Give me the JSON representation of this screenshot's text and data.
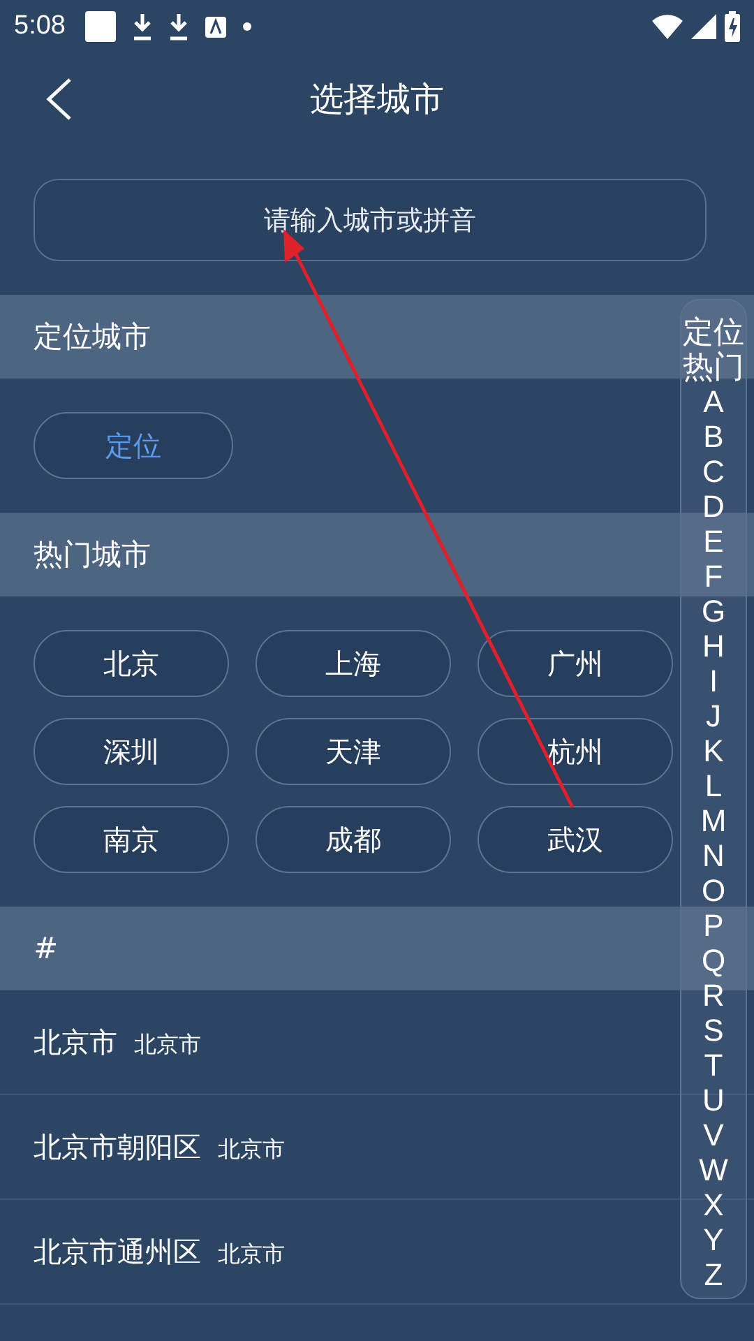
{
  "status_bar": {
    "time": "5:08"
  },
  "header": {
    "title": "选择城市"
  },
  "search": {
    "placeholder": "请输入城市或拼音"
  },
  "location_section": {
    "title": "定位城市",
    "button": "定位"
  },
  "hot_section": {
    "title": "热门城市",
    "cities": [
      "北京",
      "上海",
      "广州",
      "深圳",
      "天津",
      "杭州",
      "南京",
      "成都",
      "武汉"
    ]
  },
  "list_section": {
    "title": "#",
    "rows": [
      {
        "name": "北京市",
        "province": "北京市"
      },
      {
        "name": "北京市朝阳区",
        "province": "北京市"
      },
      {
        "name": "北京市通州区",
        "province": "北京市"
      }
    ]
  },
  "index_bar": [
    "定位",
    "热门",
    "A",
    "B",
    "C",
    "D",
    "E",
    "F",
    "G",
    "H",
    "I",
    "J",
    "K",
    "L",
    "M",
    "N",
    "O",
    "P",
    "Q",
    "R",
    "S",
    "T",
    "U",
    "V",
    "W",
    "X",
    "Y",
    "Z"
  ],
  "annotation": {
    "kind": "arrow"
  }
}
